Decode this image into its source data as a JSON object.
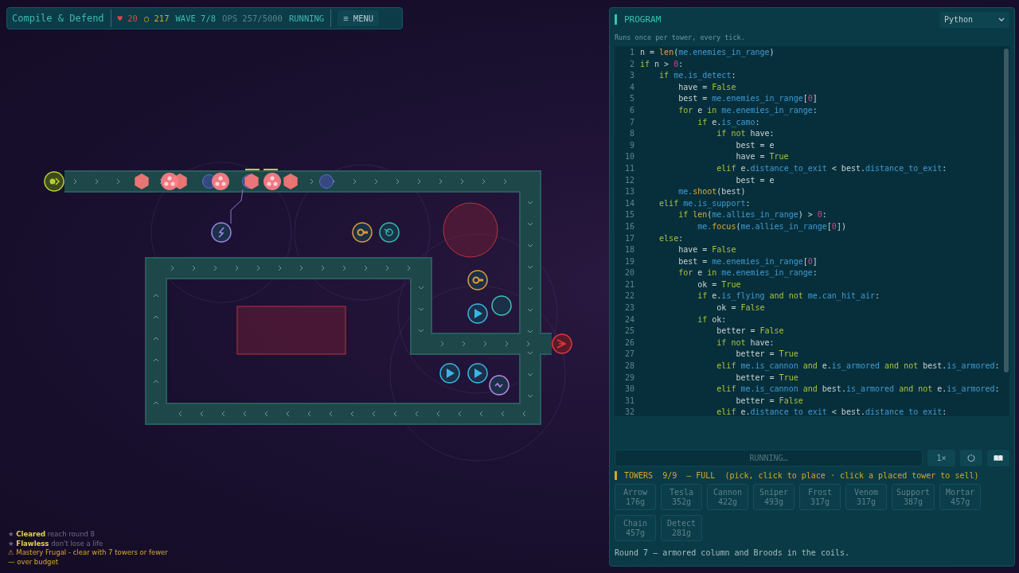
{
  "hud": {
    "title": "Compile & Defend",
    "lives_icon": "♥",
    "lives": "20",
    "gold_icon": "○",
    "gold": "217",
    "wave": "WAVE 7/8",
    "ops": "OPS 257/5000",
    "status": "RUNNING",
    "menu_button": "≡ MENU"
  },
  "achievements": [
    {
      "kind": "done",
      "text": "★ **Cleared** reach round 8"
    },
    {
      "kind": "done",
      "text": "★ **Flawless** don't lose a life"
    },
    {
      "kind": "warn",
      "text": "⚠ Mastery Frugal - clear with 7 towers or fewer — over budget"
    }
  ],
  "program": {
    "title": "PROGRAM",
    "language": "Python",
    "hint": "Runs once per tower, every tick.",
    "lines": [
      {
        "number": "1",
        "tokens": [
          {
            "text": "n = ",
            "kind": "plain"
          },
          {
            "text": "len",
            "kind": "func"
          },
          {
            "text": "(",
            "kind": "plain"
          },
          {
            "text": "me.enemies_in_range",
            "kind": "attr"
          },
          {
            "text": ")",
            "kind": "plain"
          }
        ]
      },
      {
        "number": "2",
        "tokens": [
          {
            "text": "if",
            "kind": "keyword"
          },
          {
            "text": " n > ",
            "kind": "plain"
          },
          {
            "text": "0",
            "kind": "number"
          },
          {
            "text": ":",
            "kind": "plain"
          }
        ]
      },
      {
        "number": "3",
        "tokens": [
          {
            "text": "    if ",
            "kind": "keyword"
          },
          {
            "text": "me.is_detect",
            "kind": "attr"
          },
          {
            "text": ":",
            "kind": "plain"
          }
        ]
      },
      {
        "number": "4",
        "tokens": [
          {
            "text": "        have = ",
            "kind": "plain"
          },
          {
            "text": "False",
            "kind": "keyword"
          }
        ]
      },
      {
        "number": "5",
        "tokens": [
          {
            "text": "        best = ",
            "kind": "plain"
          },
          {
            "text": "me.enemies_in_range",
            "kind": "attr"
          },
          {
            "text": "[",
            "kind": "plain"
          },
          {
            "text": "0",
            "kind": "number"
          },
          {
            "text": "]",
            "kind": "plain"
          }
        ]
      },
      {
        "number": "6",
        "tokens": [
          {
            "text": "        for",
            "kind": "keyword"
          },
          {
            "text": " e ",
            "kind": "plain"
          },
          {
            "text": "in ",
            "kind": "keyword"
          },
          {
            "text": "me.enemies_in_range",
            "kind": "attr"
          },
          {
            "text": ":",
            "kind": "plain"
          }
        ]
      },
      {
        "number": "7",
        "tokens": [
          {
            "text": "            if",
            "kind": "keyword"
          },
          {
            "text": " e.",
            "kind": "plain"
          },
          {
            "text": "is_camo",
            "kind": "attr"
          },
          {
            "text": ":",
            "kind": "plain"
          }
        ]
      },
      {
        "number": "8",
        "tokens": [
          {
            "text": "                if not",
            "kind": "keyword"
          },
          {
            "text": " have:",
            "kind": "plain"
          }
        ]
      },
      {
        "number": "9",
        "tokens": [
          {
            "text": "                    best = e",
            "kind": "plain"
          }
        ]
      },
      {
        "number": "10",
        "tokens": [
          {
            "text": "                    have = ",
            "kind": "plain"
          },
          {
            "text": "True",
            "kind": "keyword"
          }
        ]
      },
      {
        "number": "11",
        "tokens": [
          {
            "text": "                elif",
            "kind": "keyword"
          },
          {
            "text": " e.",
            "kind": "plain"
          },
          {
            "text": "distance_to_exit",
            "kind": "attr"
          },
          {
            "text": " < best.",
            "kind": "plain"
          },
          {
            "text": "distance_to_exit",
            "kind": "attr"
          },
          {
            "text": ":",
            "kind": "plain"
          }
        ]
      },
      {
        "number": "12",
        "tokens": [
          {
            "text": "                    best = e",
            "kind": "plain"
          }
        ]
      },
      {
        "number": "13",
        "tokens": [
          {
            "text": "        me.",
            "kind": "attr"
          },
          {
            "text": "shoot",
            "kind": "func"
          },
          {
            "text": "(best)",
            "kind": "plain"
          }
        ]
      },
      {
        "number": "14",
        "tokens": [
          {
            "text": "    elif ",
            "kind": "keyword"
          },
          {
            "text": "me.is_support",
            "kind": "attr"
          },
          {
            "text": ":",
            "kind": "plain"
          }
        ]
      },
      {
        "number": "15",
        "tokens": [
          {
            "text": "        if ",
            "kind": "keyword"
          },
          {
            "text": "len",
            "kind": "func"
          },
          {
            "text": "(",
            "kind": "plain"
          },
          {
            "text": "me.allies_in_range",
            "kind": "attr"
          },
          {
            "text": ") > ",
            "kind": "plain"
          },
          {
            "text": "0",
            "kind": "number"
          },
          {
            "text": ":",
            "kind": "plain"
          }
        ]
      },
      {
        "number": "16",
        "tokens": [
          {
            "text": "            me.",
            "kind": "attr"
          },
          {
            "text": "focus",
            "kind": "func"
          },
          {
            "text": "(",
            "kind": "plain"
          },
          {
            "text": "me.allies_in_range",
            "kind": "attr"
          },
          {
            "text": "[",
            "kind": "plain"
          },
          {
            "text": "0",
            "kind": "number"
          },
          {
            "text": "])",
            "kind": "plain"
          }
        ]
      },
      {
        "number": "17",
        "tokens": [
          {
            "text": "    else",
            "kind": "keyword"
          },
          {
            "text": ":",
            "kind": "plain"
          }
        ]
      },
      {
        "number": "18",
        "tokens": [
          {
            "text": "        have = ",
            "kind": "plain"
          },
          {
            "text": "False",
            "kind": "keyword"
          }
        ]
      },
      {
        "number": "19",
        "tokens": [
          {
            "text": "        best = ",
            "kind": "plain"
          },
          {
            "text": "me.enemies_in_range",
            "kind": "attr"
          },
          {
            "text": "[",
            "kind": "plain"
          },
          {
            "text": "0",
            "kind": "number"
          },
          {
            "text": "]",
            "kind": "plain"
          }
        ]
      },
      {
        "number": "20",
        "tokens": [
          {
            "text": "        for",
            "kind": "keyword"
          },
          {
            "text": " e ",
            "kind": "plain"
          },
          {
            "text": "in ",
            "kind": "keyword"
          },
          {
            "text": "me.enemies_in_range",
            "kind": "attr"
          },
          {
            "text": ":",
            "kind": "plain"
          }
        ]
      },
      {
        "number": "21",
        "tokens": [
          {
            "text": "            ok = ",
            "kind": "plain"
          },
          {
            "text": "True",
            "kind": "keyword"
          }
        ]
      },
      {
        "number": "22",
        "tokens": [
          {
            "text": "            if",
            "kind": "keyword"
          },
          {
            "text": " e.",
            "kind": "plain"
          },
          {
            "text": "is_flying ",
            "kind": "attr"
          },
          {
            "text": "and not ",
            "kind": "keyword"
          },
          {
            "text": "me.can_hit_air",
            "kind": "attr"
          },
          {
            "text": ":",
            "kind": "plain"
          }
        ]
      },
      {
        "number": "23",
        "tokens": [
          {
            "text": "                ok = ",
            "kind": "plain"
          },
          {
            "text": "False",
            "kind": "keyword"
          }
        ]
      },
      {
        "number": "24",
        "tokens": [
          {
            "text": "            if",
            "kind": "keyword"
          },
          {
            "text": " ok:",
            "kind": "plain"
          }
        ]
      },
      {
        "number": "25",
        "tokens": [
          {
            "text": "                better = ",
            "kind": "plain"
          },
          {
            "text": "False",
            "kind": "keyword"
          }
        ]
      },
      {
        "number": "26",
        "tokens": [
          {
            "text": "                if not",
            "kind": "keyword"
          },
          {
            "text": " have:",
            "kind": "plain"
          }
        ]
      },
      {
        "number": "27",
        "tokens": [
          {
            "text": "                    better = ",
            "kind": "plain"
          },
          {
            "text": "True",
            "kind": "keyword"
          }
        ]
      },
      {
        "number": "28",
        "tokens": [
          {
            "text": "                elif ",
            "kind": "keyword"
          },
          {
            "text": "me.is_cannon ",
            "kind": "attr"
          },
          {
            "text": "and",
            "kind": "keyword"
          },
          {
            "text": " e.",
            "kind": "plain"
          },
          {
            "text": "is_armored ",
            "kind": "attr"
          },
          {
            "text": "and not",
            "kind": "keyword"
          },
          {
            "text": " best.",
            "kind": "plain"
          },
          {
            "text": "is_armored",
            "kind": "attr"
          },
          {
            "text": ":",
            "kind": "plain"
          }
        ]
      },
      {
        "number": "29",
        "tokens": [
          {
            "text": "                    better = ",
            "kind": "plain"
          },
          {
            "text": "True",
            "kind": "keyword"
          }
        ]
      },
      {
        "number": "30",
        "tokens": [
          {
            "text": "                elif ",
            "kind": "keyword"
          },
          {
            "text": "me.is_cannon ",
            "kind": "attr"
          },
          {
            "text": "and",
            "kind": "keyword"
          },
          {
            "text": " best.",
            "kind": "plain"
          },
          {
            "text": "is_armored ",
            "kind": "attr"
          },
          {
            "text": "and not",
            "kind": "keyword"
          },
          {
            "text": " e.",
            "kind": "plain"
          },
          {
            "text": "is_armored",
            "kind": "attr"
          },
          {
            "text": ":",
            "kind": "plain"
          }
        ]
      },
      {
        "number": "31",
        "tokens": [
          {
            "text": "                    better = ",
            "kind": "plain"
          },
          {
            "text": "False",
            "kind": "keyword"
          }
        ]
      },
      {
        "number": "32",
        "tokens": [
          {
            "text": "                elif",
            "kind": "keyword"
          },
          {
            "text": " e.",
            "kind": "plain"
          },
          {
            "text": "distance_to_exit",
            "kind": "attr"
          },
          {
            "text": " < best.",
            "kind": "plain"
          },
          {
            "text": "distance_to_exit",
            "kind": "attr"
          },
          {
            "text": ":",
            "kind": "plain"
          }
        ]
      }
    ]
  },
  "run_bar": {
    "run_button": "RUNNING…",
    "speed_button": "1×"
  },
  "towers": {
    "title": "TOWERS  9/9  — FULL  (pick, click to place · click a placed tower to sell)",
    "items": [
      {
        "name": "Arrow",
        "cost": "176g",
        "disabled": true
      },
      {
        "name": "Tesla",
        "cost": "352g",
        "disabled": true
      },
      {
        "name": "Cannon",
        "cost": "422g",
        "disabled": true
      },
      {
        "name": "Sniper",
        "cost": "493g",
        "disabled": true
      },
      {
        "name": "Frost",
        "cost": "317g",
        "disabled": true
      },
      {
        "name": "Venom",
        "cost": "317g",
        "disabled": true
      },
      {
        "name": "Support",
        "cost": "387g",
        "disabled": true
      },
      {
        "name": "Mortar",
        "cost": "457g",
        "disabled": true
      },
      {
        "name": "Chain",
        "cost": "457g",
        "disabled": true
      },
      {
        "name": "Detect",
        "cost": "281g",
        "disabled": true
      }
    ]
  },
  "round_text": "Round 7 — armored column and Broods in the coils."
}
